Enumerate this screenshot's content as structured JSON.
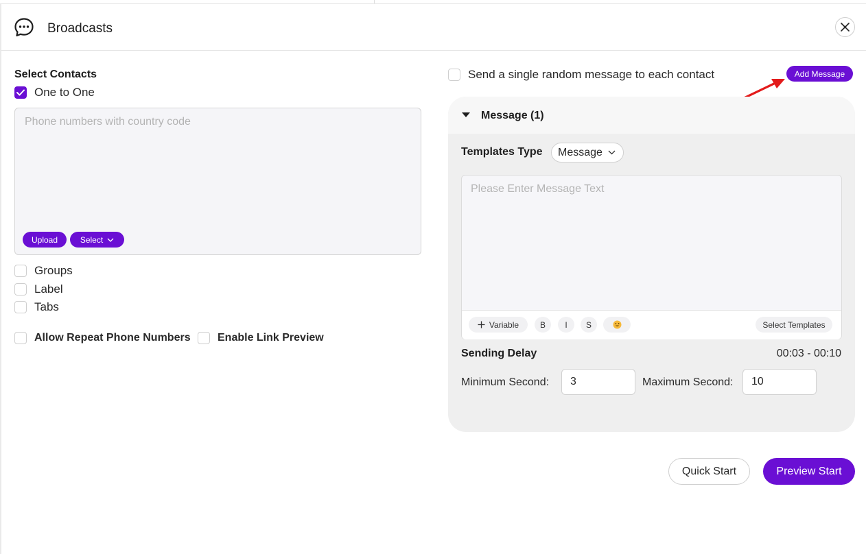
{
  "header": {
    "title": "Broadcasts",
    "app_icon": "chat-bubble-icon",
    "close_icon": "close-icon"
  },
  "contacts": {
    "section_label": "Select Contacts",
    "one_to_one": {
      "label": "One to One",
      "checked": true
    },
    "phone_input": {
      "placeholder": "Phone numbers with country code",
      "value": ""
    },
    "upload_label": "Upload",
    "select_label": "Select",
    "options": [
      {
        "label": "Groups",
        "checked": false
      },
      {
        "label": "Label",
        "checked": false
      },
      {
        "label": "Tabs",
        "checked": false
      }
    ],
    "allow_repeat": {
      "label": "Allow Repeat Phone Numbers",
      "checked": false
    },
    "link_preview": {
      "label": "Enable Link Preview",
      "checked": false
    }
  },
  "message_settings": {
    "random_message": {
      "label": "Send a single random message to each contact",
      "checked": false
    },
    "add_message_label": "Add Message",
    "panel_title": "Message (1)",
    "templates_type_label": "Templates Type",
    "templates_type_value": "Message",
    "message_input": {
      "placeholder": "Please Enter Message Text",
      "value": ""
    },
    "toolbar": {
      "variable_label": "Variable",
      "bold_label": "B",
      "italic_label": "I",
      "strike_label": "S",
      "emoji_icon": "emoji-icon",
      "select_templates_label": "Select Templates"
    },
    "sending_delay_label": "Sending Delay",
    "sending_delay_range": "00:03 - 00:10",
    "min_label": "Minimum Second",
    "min_value": "3",
    "max_label": "Maximum Second",
    "max_value": "10"
  },
  "actions": {
    "quick_start": "Quick Start",
    "preview_start": "Preview Start"
  },
  "colors": {
    "accent": "#6a0fd4",
    "panel_bg": "#efefef",
    "annotation_arrow": "#e31b1b"
  }
}
